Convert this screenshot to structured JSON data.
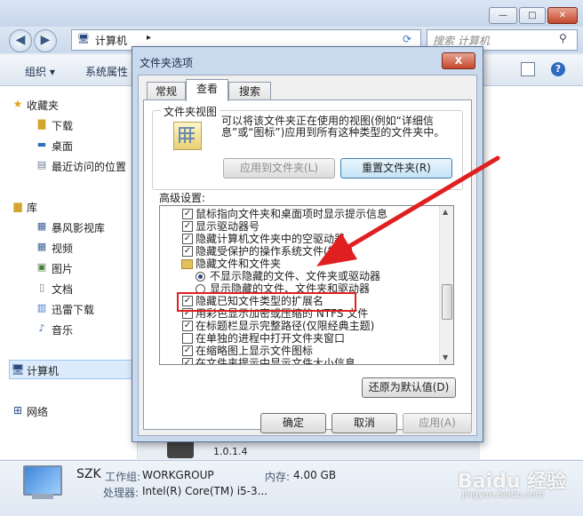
{
  "explorer": {
    "breadcrumb": "计算机",
    "search_placeholder": "搜索 计算机",
    "toolbar": {
      "organize": "组织 ▾",
      "system_properties": "系统属性"
    },
    "sidebar": {
      "favorites": "收藏夹",
      "favorites_items": [
        "下载",
        "桌面",
        "最近访问的位置"
      ],
      "library": "库",
      "library_items": [
        "暴风影视库",
        "视频",
        "图片",
        "文档",
        "迅雷下载",
        "音乐"
      ],
      "computer": "计算机",
      "network": "网络"
    },
    "hidden_version": "1.0.1.4",
    "details": {
      "name": "SZK",
      "workgroup_label": "工作组:",
      "workgroup": "WORKGROUP",
      "memory_label": "内存:",
      "memory": "4.00 GB",
      "cpu_label": "处理器:",
      "cpu": "Intel(R) Core(TM) i5-3..."
    }
  },
  "dialog": {
    "title": "文件夹选项",
    "close_label": "X",
    "tabs": [
      "常规",
      "查看",
      "搜索"
    ],
    "active_tab": "查看",
    "folder_view": {
      "title": "文件夹视图",
      "description": "可以将该文件夹正在使用的视图(例如“详细信息”或“图标”)应用到所有这种类型的文件夹中。",
      "apply_button": "应用到文件夹(L)",
      "reset_button": "重置文件夹(R)"
    },
    "advanced_label": "高级设置:",
    "settings": [
      {
        "type": "checkbox",
        "checked": true,
        "label": "鼠标指向文件夹和桌面项时显示提示信息"
      },
      {
        "type": "checkbox",
        "checked": true,
        "label": "显示驱动器号"
      },
      {
        "type": "checkbox",
        "checked": true,
        "label": "隐藏计算机文件夹中的空驱动器"
      },
      {
        "type": "checkbox",
        "checked": true,
        "label": "隐藏受保护的操作系统文件(推荐)"
      },
      {
        "type": "folder",
        "label": "隐藏文件和文件夹"
      },
      {
        "type": "radio",
        "checked": true,
        "label": "不显示隐藏的文件、文件夹或驱动器"
      },
      {
        "type": "radio",
        "checked": false,
        "label": "显示隐藏的文件、文件夹和驱动器"
      },
      {
        "type": "checkbox",
        "checked": true,
        "label": "隐藏已知文件类型的扩展名"
      },
      {
        "type": "checkbox",
        "checked": true,
        "label": "用彩色显示加密或压缩的 NTFS 文件"
      },
      {
        "type": "checkbox",
        "checked": true,
        "label": "在标题栏显示完整路径(仅限经典主题)"
      },
      {
        "type": "checkbox",
        "checked": false,
        "label": "在单独的进程中打开文件夹窗口"
      },
      {
        "type": "checkbox",
        "checked": true,
        "label": "在缩略图上显示文件图标"
      },
      {
        "type": "checkbox",
        "checked": true,
        "label": "在文件夹提示中显示文件大小信息"
      }
    ],
    "restore_defaults": "还原为默认值(D)",
    "ok": "确定",
    "cancel": "取消",
    "apply": "应用(A)"
  },
  "watermark": {
    "brand": "Baidu 经验",
    "url": "jingyan.baidu.com"
  },
  "colors": {
    "highlight_box": "#e02020",
    "arrow": "#e02020"
  }
}
